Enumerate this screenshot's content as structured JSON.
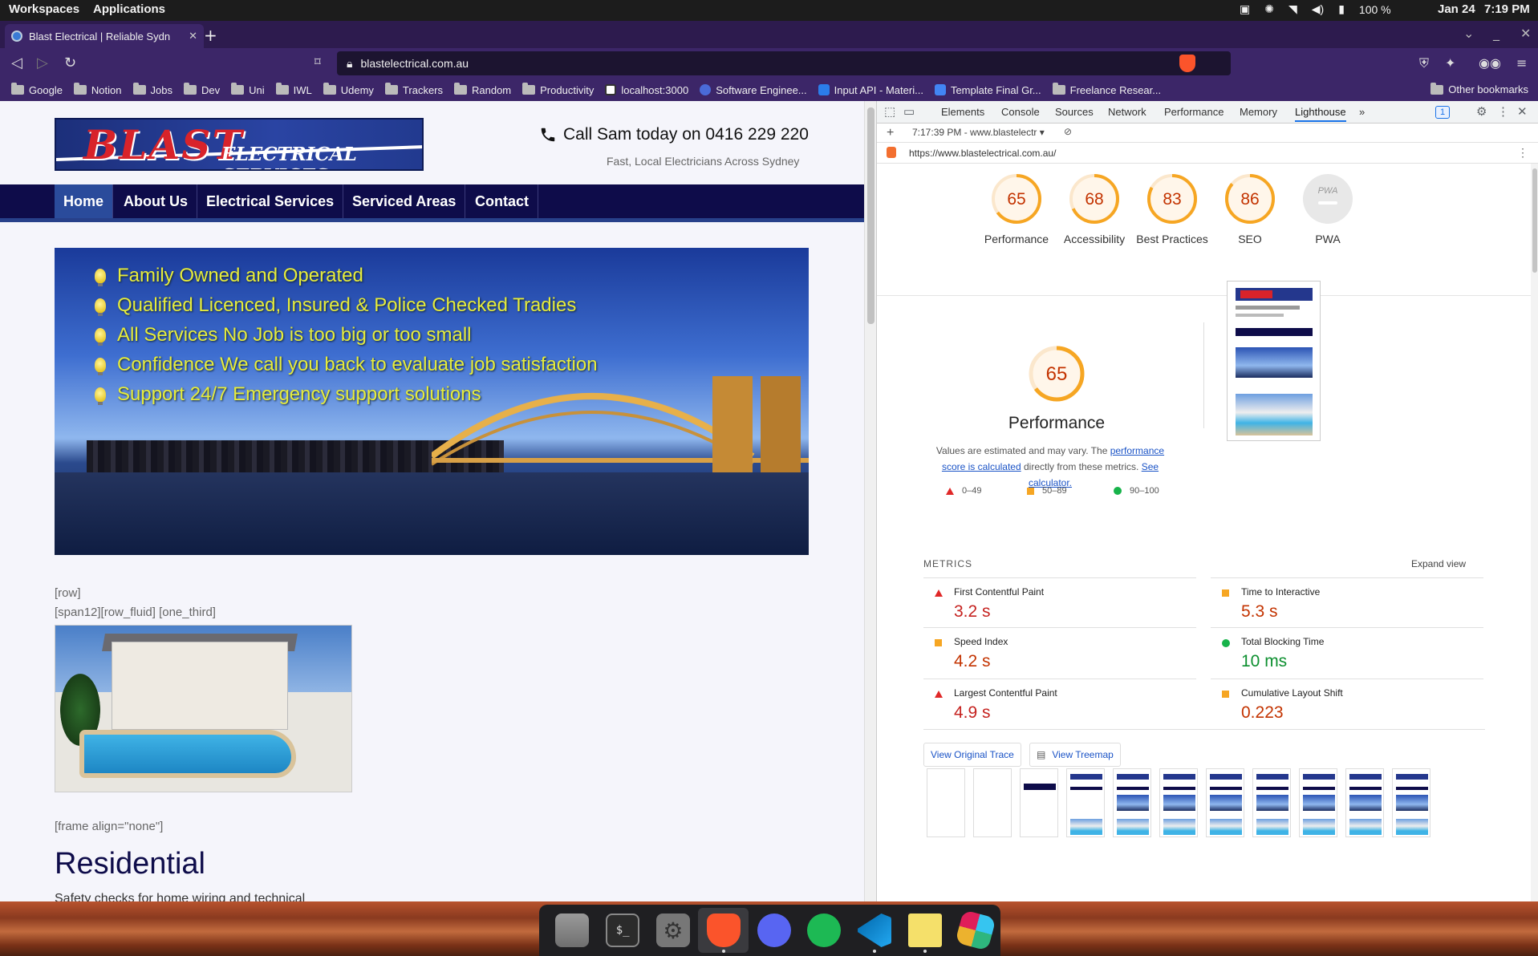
{
  "system_bar": {
    "workspaces": "Workspaces",
    "applications": "Applications",
    "battery": "100 %",
    "date": "Jan 24",
    "time": "7:19 PM"
  },
  "browser": {
    "tab_title": "Blast Electrical | Reliable Sydn",
    "url": "blastelectrical.com.au",
    "bookmarks": [
      "Google",
      "Notion",
      "Jobs",
      "Dev",
      "Uni",
      "IWL",
      "Udemy",
      "Trackers",
      "Random",
      "Productivity",
      "localhost:3000",
      "Software Enginee...",
      "Input API - Materi...",
      "Template Final Gr...",
      "Freelance Resear..."
    ],
    "other_bookmarks": "Other bookmarks"
  },
  "site": {
    "logo_blast": "BLAST",
    "logo_sub": "ELECTRICAL SERVICES",
    "call": "Call Sam today on 0416 229 220",
    "tagline": "Fast, Local Electricians Across Sydney",
    "nav": [
      "Home",
      "About Us",
      "Electrical Services",
      "Serviced Areas",
      "Contact"
    ],
    "hero_points": [
      "Family Owned and Operated",
      "Qualified Licenced, Insured & Police Checked Tradies",
      "All Services No Job is too big or too small",
      "Confidence We call you back to evaluate job satisfaction",
      "Support 24/7 Emergency support solutions"
    ],
    "shortcode_row": "[row]",
    "shortcode_span": "[span12][row_fluid] [one_third]",
    "shortcode_frame": "[frame align=\"none\"]",
    "residential_title": "Residential",
    "residential_text": "Safety checks for home wiring and technical"
  },
  "devtools": {
    "tabs": [
      "Elements",
      "Console",
      "Sources",
      "Network",
      "Performance",
      "Memory",
      "Lighthouse"
    ],
    "more_tabs": "»",
    "badge": "1",
    "run_label": "7:17:39 PM - www.blastelectr",
    "report_url": "https://www.blastelectrical.com.au/",
    "categories": [
      {
        "label": "Performance",
        "score": "65"
      },
      {
        "label": "Accessibility",
        "score": "68"
      },
      {
        "label": "Best Practices",
        "score": "83"
      },
      {
        "label": "SEO",
        "score": "86"
      },
      {
        "label": "PWA",
        "score": "PWA"
      }
    ],
    "performance": {
      "score": "65",
      "title": "Performance",
      "desc_1": "Values are estimated and may vary. The ",
      "desc_link_1": "performance score is calculated",
      "desc_2": " directly from these metrics. ",
      "desc_link_2": "See calculator.",
      "legend": [
        "0–49",
        "50–89",
        "90–100"
      ]
    },
    "metrics_header": "METRICS",
    "expand_view": "Expand view",
    "metrics": [
      {
        "name": "First Contentful Paint",
        "value": "3.2 s",
        "rating": "fail"
      },
      {
        "name": "Time to Interactive",
        "value": "5.3 s",
        "rating": "average"
      },
      {
        "name": "Speed Index",
        "value": "4.2 s",
        "rating": "average"
      },
      {
        "name": "Total Blocking Time",
        "value": "10 ms",
        "rating": "pass"
      },
      {
        "name": "Largest Contentful Paint",
        "value": "4.9 s",
        "rating": "fail"
      },
      {
        "name": "Cumulative Layout Shift",
        "value": "0.223",
        "rating": "average"
      }
    ],
    "view_trace": "View Original Trace",
    "view_treemap": "View Treemap"
  },
  "colors": {
    "score_average": "#f6a623",
    "score_average_text": "#c33300",
    "metric_fail": "#c5221f",
    "metric_pass": "#0c8f2f"
  },
  "dock": [
    "files-icon",
    "terminal-icon",
    "settings-icon",
    "brave-icon",
    "discord-icon",
    "spotify-icon",
    "vscode-icon",
    "sticky-notes-icon",
    "slack-icon"
  ]
}
